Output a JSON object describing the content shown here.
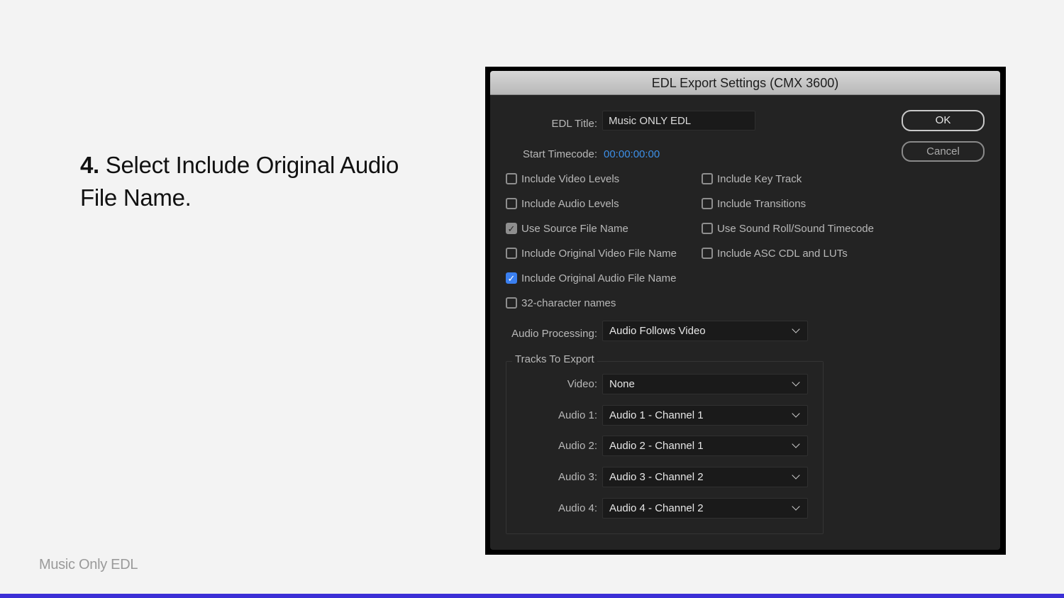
{
  "slide": {
    "step_number": "4.",
    "step_text": " Select Include Original Audio File Name.",
    "footer": "Music Only EDL",
    "accent_color": "#3b2fd6"
  },
  "dialog": {
    "title": "EDL Export Settings (CMX 3600)",
    "edl_title_label": "EDL Title:",
    "edl_title_value": "Music ONLY EDL",
    "start_timecode_label": "Start Timecode:",
    "start_timecode_value": "00:00:00:00",
    "ok_label": "OK",
    "cancel_label": "Cancel",
    "checkboxes_left": [
      {
        "label": "Include Video Levels",
        "checked": false
      },
      {
        "label": "Include Audio Levels",
        "checked": false
      },
      {
        "label": "Use Source File Name",
        "checked": true,
        "disabled": true
      },
      {
        "label": "Include Original Video File Name",
        "checked": false
      },
      {
        "label": "Include Original Audio File Name",
        "checked": true
      },
      {
        "label": "32-character names",
        "checked": false
      }
    ],
    "checkboxes_right": [
      {
        "label": "Include Key Track",
        "checked": false
      },
      {
        "label": "Include Transitions",
        "checked": false
      },
      {
        "label": "Use Sound Roll/Sound Timecode",
        "checked": false
      },
      {
        "label": "Include ASC CDL and LUTs",
        "checked": false
      }
    ],
    "audio_processing_label": "Audio Processing:",
    "audio_processing_value": "Audio Follows Video",
    "tracks_group_title": "Tracks To Export",
    "tracks": [
      {
        "label": "Video:",
        "value": "None"
      },
      {
        "label": "Audio 1:",
        "value": "Audio 1 - Channel 1"
      },
      {
        "label": "Audio 2:",
        "value": "Audio 2 - Channel 1"
      },
      {
        "label": "Audio 3:",
        "value": "Audio 3 - Channel 2"
      },
      {
        "label": "Audio 4:",
        "value": "Audio 4 - Channel 2"
      }
    ],
    "check_glyph": "✓"
  }
}
